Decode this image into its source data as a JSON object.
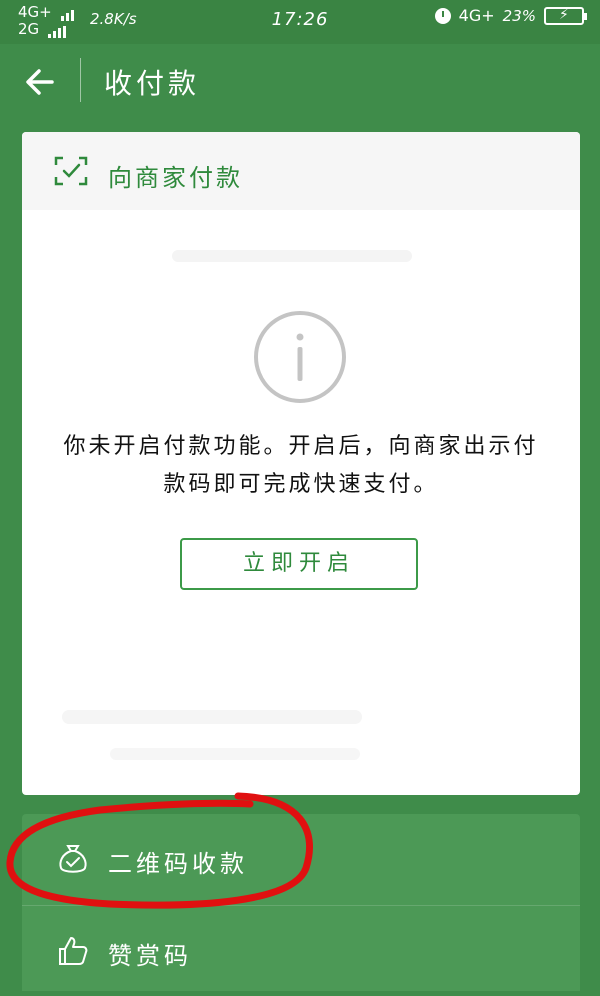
{
  "status_bar": {
    "network_top": "4G+",
    "network_bottom": "2G",
    "speed": "2.8K/s",
    "time": "17:26",
    "network_right": "4G+",
    "battery_percent": "23%",
    "alarm_icon": "alarm-clock-icon",
    "battery_icon": "battery-charging-icon"
  },
  "titlebar": {
    "back_icon": "arrow-left-icon",
    "title": "收付款"
  },
  "card": {
    "header_icon": "scan-check-icon",
    "header_label": "向商家付款",
    "info_icon": "info-circle-icon",
    "notice": "你未开启付款功能。开启后，向商家出示付款码即可完成快速支付。",
    "enable_button": "立即开启"
  },
  "bottom_list": {
    "items": [
      {
        "icon": "money-bag-check-icon",
        "label": "二维码收款"
      },
      {
        "icon": "thumbs-up-icon",
        "label": "赞赏码"
      }
    ]
  },
  "colors": {
    "background": "#3f8c4a",
    "accent": "#2f8a3c",
    "card": "#ffffff",
    "annotation": "#e01010"
  }
}
